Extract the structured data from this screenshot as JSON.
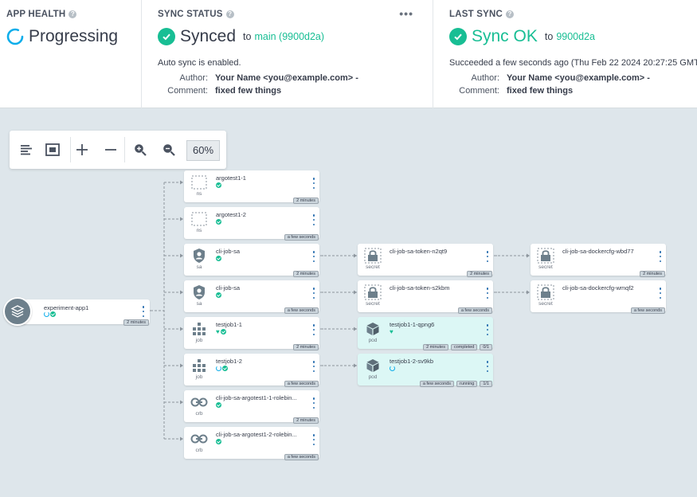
{
  "app_health": {
    "heading": "APP HEALTH",
    "status": "Progressing"
  },
  "sync_status": {
    "heading": "SYNC STATUS",
    "status": "Synced",
    "to_word": "to",
    "revision": "main (9900d2a)",
    "auto_sync": "Auto sync is enabled.",
    "author_label": "Author:",
    "author": "Your Name <you@example.com> -",
    "comment_label": "Comment:",
    "comment": "fixed few things"
  },
  "last_sync": {
    "heading": "LAST SYNC",
    "status": "Sync OK",
    "to_word": "to",
    "revision": "9900d2a",
    "result": "Succeeded a few seconds ago (Thu Feb 22 2024 20:27:25 GMT",
    "author_label": "Author:",
    "author": "Your Name <you@example.com> -",
    "comment_label": "Comment:",
    "comment": "fixed few things"
  },
  "toolbar": {
    "zoom": "60%"
  },
  "colors": {
    "accent_green": "#18be94",
    "progress_blue": "#0dadea",
    "pod_bg": "#dcf7f5",
    "canvas_bg": "#dee6eb"
  },
  "graph": {
    "root": {
      "name": "experiment-app1",
      "tag": "2 minutes",
      "icon": "layers-icon"
    },
    "nodes": [
      {
        "name": "argotest1-1",
        "kind": "ns",
        "icon": "namespace-icon",
        "status": [
          "check"
        ],
        "tags": [
          "2 minutes"
        ]
      },
      {
        "name": "argotest1-2",
        "kind": "ns",
        "icon": "namespace-icon",
        "status": [
          "check"
        ],
        "tags": [
          "a few seconds"
        ]
      },
      {
        "name": "cli-job-sa",
        "kind": "sa",
        "icon": "service-account-icon",
        "status": [
          "check"
        ],
        "tags": [
          "2 minutes"
        ]
      },
      {
        "name": "cli-job-sa",
        "kind": "sa",
        "icon": "service-account-icon",
        "status": [
          "check"
        ],
        "tags": [
          "a few seconds"
        ]
      },
      {
        "name": "testjob1-1",
        "kind": "job",
        "icon": "job-icon",
        "status": [
          "heart",
          "check"
        ],
        "tags": [
          "2 minutes"
        ]
      },
      {
        "name": "testjob1-2",
        "kind": "job",
        "icon": "job-icon",
        "status": [
          "progress",
          "check"
        ],
        "tags": [
          "a few seconds"
        ]
      },
      {
        "name": "cli-job-sa-argotest1-1-rolebin...",
        "kind": "crb",
        "icon": "link-icon",
        "status": [
          "check"
        ],
        "tags": [
          "2 minutes"
        ]
      },
      {
        "name": "cli-job-sa-argotest1-2-rolebin...",
        "kind": "crb",
        "icon": "link-icon",
        "status": [
          "check"
        ],
        "tags": [
          "a few seconds"
        ]
      },
      {
        "name": "cli-job-sa-token-n2qt9",
        "kind": "secret",
        "icon": "secret-icon",
        "status": [],
        "tags": [
          "2 minutes"
        ]
      },
      {
        "name": "cli-job-sa-token-s2kbm",
        "kind": "secret",
        "icon": "secret-icon",
        "status": [],
        "tags": [
          "a few seconds"
        ]
      },
      {
        "name": "testjob1-1-qpng6",
        "kind": "pod",
        "icon": "pod-icon",
        "status": [
          "heart"
        ],
        "tags": [
          "2 minutes",
          "completed",
          "0/1"
        ]
      },
      {
        "name": "testjob1-2-sv9kb",
        "kind": "pod",
        "icon": "pod-icon",
        "status": [
          "progress"
        ],
        "tags": [
          "a few seconds",
          "running",
          "1/1"
        ]
      },
      {
        "name": "cli-job-sa-dockercfg-wbd77",
        "kind": "secret",
        "icon": "secret-icon",
        "status": [],
        "tags": [
          "2 minutes"
        ]
      },
      {
        "name": "cli-job-sa-dockercfg-wmqf2",
        "kind": "secret",
        "icon": "secret-icon",
        "status": [],
        "tags": [
          "a few seconds"
        ]
      }
    ]
  }
}
